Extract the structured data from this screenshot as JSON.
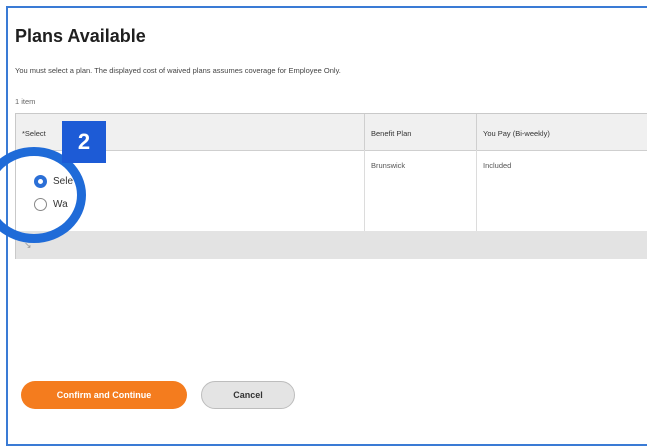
{
  "page": {
    "title": "Plans Available",
    "note": "You must select a plan. The displayed cost of waived plans assumes coverage for Employee Only.",
    "item_count": "1 item"
  },
  "table": {
    "headers": {
      "select": "*Select",
      "plan": "Benefit Plan",
      "pay": "You Pay (Bi-weekly)"
    },
    "row": {
      "options": [
        {
          "label": "Sele",
          "selected": true
        },
        {
          "label": "Wa",
          "selected": false
        }
      ],
      "plan": "Brunswick",
      "pay": "Included"
    }
  },
  "callout": {
    "step": "2"
  },
  "buttons": {
    "confirm": "Confirm and Continue",
    "cancel": "Cancel"
  },
  "colors": {
    "accent": "#f47c1e",
    "callout": "#1d5bd6",
    "radio": "#2b6fd6"
  }
}
